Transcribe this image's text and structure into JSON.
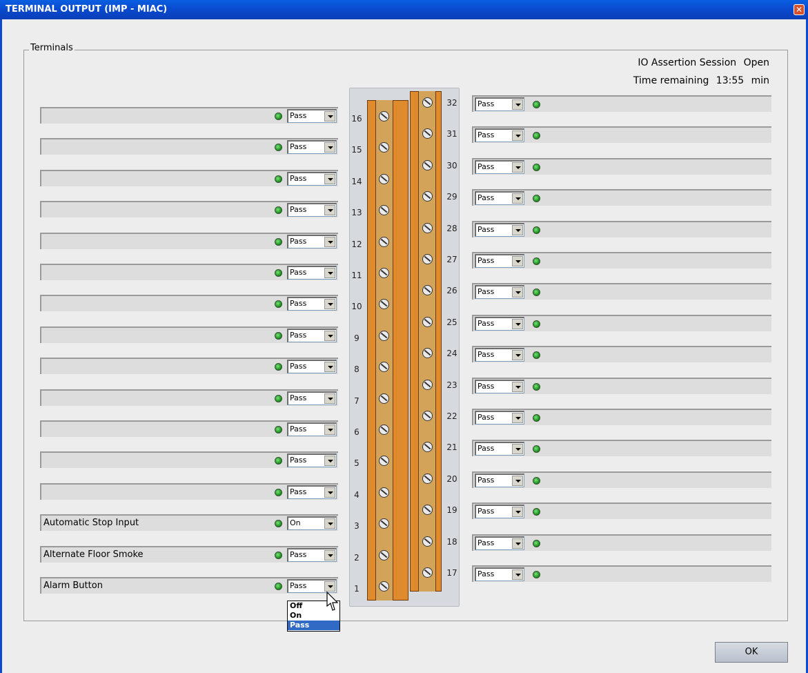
{
  "window": {
    "title": "TERMINAL OUTPUT (IMP - MIAC)",
    "close_glyph": "✕"
  },
  "group_label": "Terminals",
  "session": {
    "status_label": "IO Assertion Session",
    "status_value": "Open",
    "time_label": "Time remaining",
    "time_value": "13:55",
    "time_unit": "min"
  },
  "left_terminals": [
    {
      "number": "16",
      "name": "",
      "mode": "Pass"
    },
    {
      "number": "15",
      "name": "",
      "mode": "Pass"
    },
    {
      "number": "14",
      "name": "",
      "mode": "Pass"
    },
    {
      "number": "13",
      "name": "",
      "mode": "Pass"
    },
    {
      "number": "12",
      "name": "",
      "mode": "Pass"
    },
    {
      "number": "11",
      "name": "",
      "mode": "Pass"
    },
    {
      "number": "10",
      "name": "",
      "mode": "Pass"
    },
    {
      "number": "9",
      "name": "",
      "mode": "Pass"
    },
    {
      "number": "8",
      "name": "",
      "mode": "Pass"
    },
    {
      "number": "7",
      "name": "",
      "mode": "Pass"
    },
    {
      "number": "6",
      "name": "",
      "mode": "Pass"
    },
    {
      "number": "5",
      "name": "",
      "mode": "Pass"
    },
    {
      "number": "4",
      "name": "",
      "mode": "Pass"
    },
    {
      "number": "3",
      "name": "Automatic Stop Input",
      "mode": "On"
    },
    {
      "number": "2",
      "name": "Alternate Floor Smoke",
      "mode": "Pass"
    },
    {
      "number": "1",
      "name": "Alarm Button",
      "mode": "Pass"
    }
  ],
  "right_terminals": [
    {
      "number": "32",
      "name": "",
      "mode": "Pass"
    },
    {
      "number": "31",
      "name": "",
      "mode": "Pass"
    },
    {
      "number": "30",
      "name": "",
      "mode": "Pass"
    },
    {
      "number": "29",
      "name": "",
      "mode": "Pass"
    },
    {
      "number": "28",
      "name": "",
      "mode": "Pass"
    },
    {
      "number": "27",
      "name": "",
      "mode": "Pass"
    },
    {
      "number": "26",
      "name": "",
      "mode": "Pass"
    },
    {
      "number": "25",
      "name": "",
      "mode": "Pass"
    },
    {
      "number": "24",
      "name": "",
      "mode": "Pass"
    },
    {
      "number": "23",
      "name": "",
      "mode": "Pass"
    },
    {
      "number": "22",
      "name": "",
      "mode": "Pass"
    },
    {
      "number": "21",
      "name": "",
      "mode": "Pass"
    },
    {
      "number": "20",
      "name": "",
      "mode": "Pass"
    },
    {
      "number": "19",
      "name": "",
      "mode": "Pass"
    },
    {
      "number": "18",
      "name": "",
      "mode": "Pass"
    },
    {
      "number": "17",
      "name": "",
      "mode": "Pass"
    }
  ],
  "dropdown_options": [
    "Off",
    "On",
    "Pass"
  ],
  "dropdown_selected": "Pass",
  "ok_label": "OK",
  "colors": {
    "title_bar": "#0a4bd0",
    "led_green": "#138a13",
    "terminal_orange": "#e08a2e",
    "selection_blue": "#316ac5"
  }
}
